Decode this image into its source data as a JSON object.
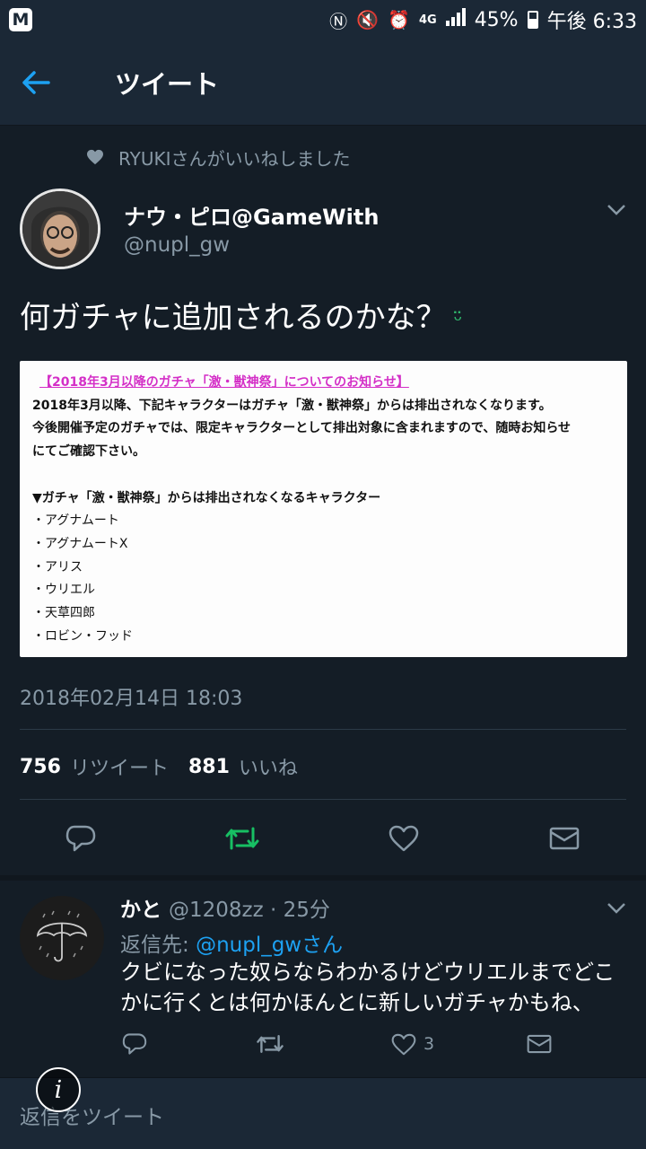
{
  "status_bar": {
    "app_badge": "M",
    "battery_percent": "45%",
    "network": "4G",
    "time": "午後 6:33"
  },
  "header": {
    "title": "ツイート"
  },
  "tweet": {
    "social_context": "RYUKIさんがいいねしました",
    "author_name": "ナウ・ピロ@GameWith",
    "author_handle": "@nupl_gw",
    "text": "何ガチャに追加されるのかな？",
    "emoji": "ᵕ̈",
    "image": {
      "title": "【2018年3月以降のガチャ「激・獣神祭」についてのお知らせ】",
      "line1": "2018年3月以降、下記キャラクターはガチャ「激・獣神祭」からは排出されなくなります。",
      "line2": "今後開催予定のガチャでは、限定キャラクターとして排出対象に含まれますので、随時お知らせ",
      "line3": "にてご確認下さい。",
      "list_heading": "▼ガチャ「激・獣神祭」からは排出されなくなるキャラクター",
      "characters": [
        "・アグナムート",
        "・アグナムートX",
        "・アリス",
        "・ウリエル",
        "・天草四郎",
        "・ロビン・フッド"
      ]
    },
    "timestamp": "2018年02月14日 18:03",
    "retweet_count": "756",
    "retweet_label": "リツイート",
    "like_count": "881",
    "like_label": "いいね"
  },
  "reply": {
    "author_name": "かと",
    "meta": "@1208zz · 25分",
    "reply_to_prefix": "返信先: ",
    "reply_to_mention": "@nupl_gwさん",
    "text": "クビになった奴らならわかるけどウリエルまでどこかに行くとは何かほんとに新しいガチャかもね、",
    "like_count": "3"
  },
  "compose": {
    "placeholder": "返信をツイート"
  },
  "colors": {
    "background": "#141d26",
    "bar": "#1b2836",
    "accent": "#1da1f2",
    "retweet_active": "#17bf63",
    "secondary_text": "#8899a6",
    "image_title": "#d42fc7"
  },
  "icons": {
    "back": "arrow-left-icon",
    "liked_context": "heart-icon",
    "more": "chevron-down-icon",
    "reply": "reply-icon",
    "retweet": "retweet-icon",
    "like": "heart-icon",
    "share": "envelope-icon",
    "info": "info-icon"
  }
}
